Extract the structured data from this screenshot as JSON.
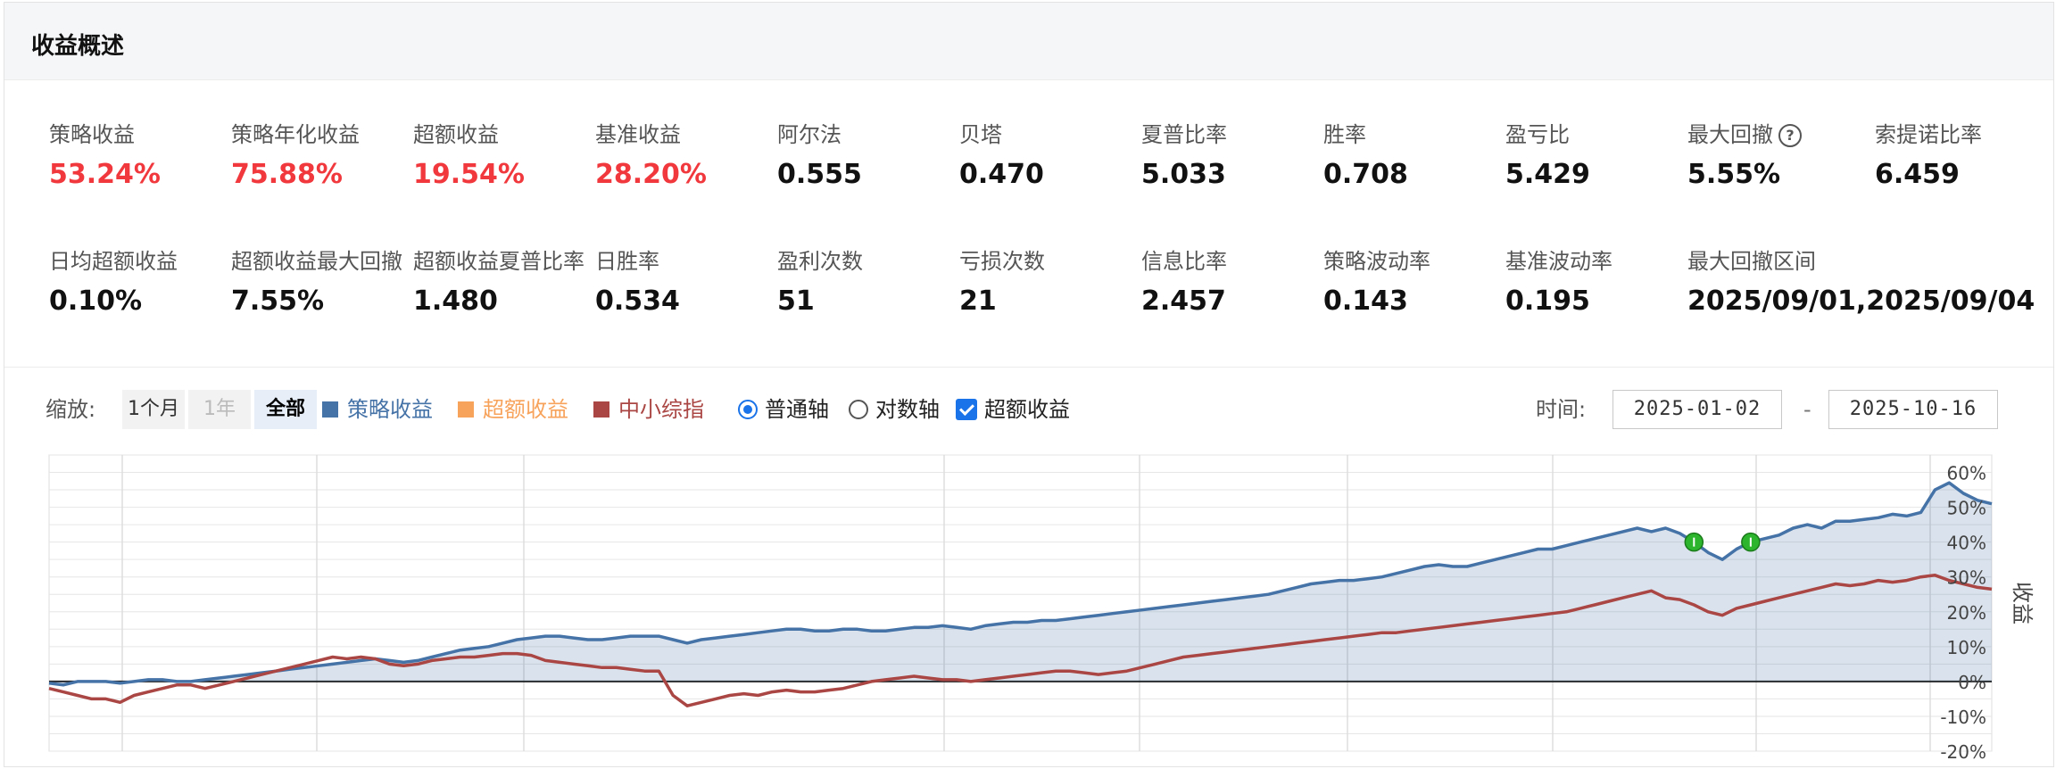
{
  "panel": {
    "title": "收益概述"
  },
  "metrics_row1": [
    {
      "label": "策略收益",
      "value": "53.24%",
      "red": true
    },
    {
      "label": "策略年化收益",
      "value": "75.88%",
      "red": true
    },
    {
      "label": "超额收益",
      "value": "19.54%",
      "red": true
    },
    {
      "label": "基准收益",
      "value": "28.20%",
      "red": true
    },
    {
      "label": "阿尔法",
      "value": "0.555"
    },
    {
      "label": "贝塔",
      "value": "0.470"
    },
    {
      "label": "夏普比率",
      "value": "5.033"
    },
    {
      "label": "胜率",
      "value": "0.708"
    },
    {
      "label": "盈亏比",
      "value": "5.429"
    },
    {
      "label": "最大回撤",
      "value": "5.55%",
      "help_icon": "question-icon"
    },
    {
      "label": "索提诺比率",
      "value": "6.459"
    }
  ],
  "metrics_row2": [
    {
      "label": "日均超额收益",
      "value": "0.10%"
    },
    {
      "label": "超额收益最大回撤",
      "value": "7.55%"
    },
    {
      "label": "超额收益夏普比率",
      "value": "1.480"
    },
    {
      "label": "日胜率",
      "value": "0.534"
    },
    {
      "label": "盈利次数",
      "value": "51"
    },
    {
      "label": "亏损次数",
      "value": "21"
    },
    {
      "label": "信息比率",
      "value": "2.457"
    },
    {
      "label": "策略波动率",
      "value": "0.143"
    },
    {
      "label": "基准波动率",
      "value": "0.195"
    },
    {
      "label": "最大回撤区间",
      "value": "2025/09/01,2025/09/04"
    }
  ],
  "toolbar": {
    "zoom_label": "缩放:",
    "zoom_options": [
      "1个月",
      "1年",
      "全部"
    ],
    "zoom_active": "全部",
    "legend": [
      {
        "name": "策略收益",
        "color": "#4572a7"
      },
      {
        "name": "超额收益",
        "color": "#f7a35c"
      },
      {
        "name": "中小综指",
        "color": "#aa4643"
      }
    ],
    "axis_options": [
      "普通轴",
      "对数轴"
    ],
    "axis_selected": "普通轴",
    "excess_checkbox": "超额收益",
    "time_label": "时间:",
    "date_from": "2025-01-02",
    "date_to": "2025-10-16",
    "date_sep": "-"
  },
  "chart_data": {
    "type": "line",
    "ylabel": "收益",
    "ylim": [
      -20,
      65
    ],
    "yticks": [
      "60%",
      "50%",
      "40%",
      "30%",
      "20%",
      "10%",
      "0%",
      "-10%",
      "-20%"
    ],
    "grid": true,
    "series": [
      {
        "name": "策略收益",
        "color": "#4572a7",
        "fill": true,
        "values": [
          -0.5,
          -1,
          0,
          0,
          0,
          -0.5,
          0,
          0.5,
          0.5,
          0,
          0,
          0.5,
          1,
          1.5,
          2,
          2.5,
          3,
          3.5,
          4,
          4.5,
          5,
          5.5,
          6,
          6.5,
          6,
          5.5,
          6,
          7,
          8,
          9,
          9.5,
          10,
          11,
          12,
          12.5,
          13,
          13,
          12.5,
          12,
          12,
          12.5,
          13,
          13,
          13,
          12,
          11,
          12,
          12.5,
          13,
          13.5,
          14,
          14.5,
          15,
          15,
          14.5,
          14.5,
          15,
          15,
          14.5,
          14.5,
          15,
          15.5,
          15.5,
          16,
          15.5,
          15,
          16,
          16.5,
          17,
          17,
          17.5,
          17.5,
          18,
          18.5,
          19,
          19.5,
          20,
          20.5,
          21,
          21.5,
          22,
          22.5,
          23,
          23.5,
          24,
          24.5,
          25,
          26,
          27,
          28,
          28.5,
          29,
          29,
          29.5,
          30,
          31,
          32,
          33,
          33.5,
          33,
          33,
          34,
          35,
          36,
          37,
          38,
          38,
          39,
          40,
          41,
          42,
          43,
          44,
          43,
          44,
          42.5,
          40,
          37,
          35,
          38,
          40,
          41,
          42,
          44,
          45,
          44,
          46,
          46,
          46.5,
          47,
          48,
          47.5,
          48.5,
          55,
          57,
          54,
          52,
          51
        ]
      },
      {
        "name": "中小综指",
        "color": "#aa4643",
        "fill": false,
        "values": [
          -2,
          -3,
          -4,
          -5,
          -5,
          -6,
          -4,
          -3,
          -2,
          -1,
          -1,
          -2,
          -1,
          0,
          1,
          2,
          3,
          4,
          5,
          6,
          7,
          6.5,
          7,
          6.5,
          5,
          4.5,
          5,
          6,
          6.5,
          7,
          7,
          7.5,
          8,
          8,
          7.5,
          6,
          5.5,
          5,
          4.5,
          4,
          4,
          3.5,
          3,
          3,
          -4,
          -7,
          -6,
          -5,
          -4,
          -3.5,
          -4,
          -3,
          -2.5,
          -3,
          -3,
          -2.5,
          -2,
          -1,
          0,
          0.5,
          1,
          1.5,
          1,
          0.5,
          0.5,
          0,
          0.5,
          1,
          1.5,
          2,
          2.5,
          3,
          3,
          2.5,
          2,
          2.5,
          3,
          4,
          5,
          6,
          7,
          7.5,
          8,
          8.5,
          9,
          9.5,
          10,
          10.5,
          11,
          11.5,
          12,
          12.5,
          13,
          13.5,
          14,
          14,
          14.5,
          15,
          15.5,
          16,
          16.5,
          17,
          17.5,
          18,
          18.5,
          19,
          19.5,
          20,
          21,
          22,
          23,
          24,
          25,
          26,
          24,
          23.5,
          22,
          20,
          19,
          21,
          22,
          23,
          24,
          25,
          26,
          27,
          28,
          27.5,
          28,
          29,
          28.5,
          29,
          30,
          30.5,
          29,
          28,
          27,
          26.5
        ]
      }
    ],
    "markers": [
      {
        "series": "策略收益",
        "index": 116,
        "color": "#2db52d"
      },
      {
        "series": "策略收益",
        "index": 120,
        "color": "#2db52d"
      }
    ]
  }
}
